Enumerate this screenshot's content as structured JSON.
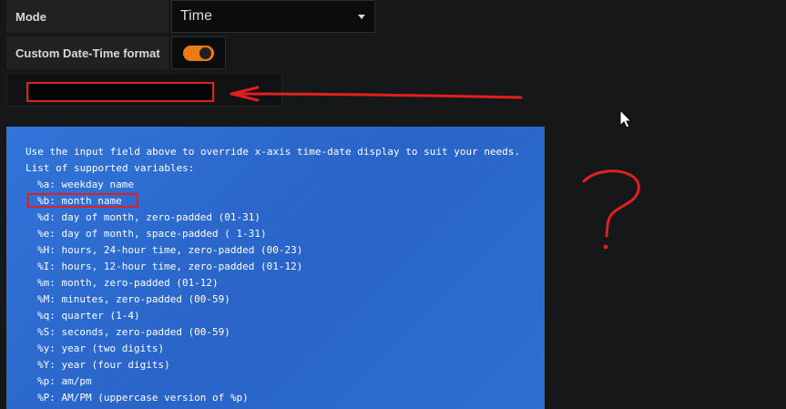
{
  "mode": {
    "label": "Mode",
    "value": "Time"
  },
  "custom_format": {
    "label": "Custom Date-Time format",
    "enabled": true,
    "input_value": ""
  },
  "help": {
    "intro": "Use the input field above to override x-axis time-date display to suit your needs.",
    "list_title": "List of supported variables:",
    "variables": [
      "%a: weekday name",
      "%b: month name",
      "%d: day of month, zero-padded (01-31)",
      "%e: day of month, space-padded ( 1-31)",
      "%H: hours, 24-hour time, zero-padded (00-23)",
      "%I: hours, 12-hour time, zero-padded (01-12)",
      "%m: month, zero-padded (01-12)",
      "%M: minutes, zero-padded (00-59)",
      "%q: quarter (1-4)",
      "%S: seconds, zero-padded (00-59)",
      "%y: year (two digits)",
      "%Y: year (four digits)",
      "%p: am/pm",
      "%P: AM/PM (uppercase version of %p)"
    ]
  },
  "annotation": {
    "symbol": "?"
  },
  "colors": {
    "accent": "#eb7b18",
    "panel": "#3274d9",
    "annotation": "#e02020"
  }
}
